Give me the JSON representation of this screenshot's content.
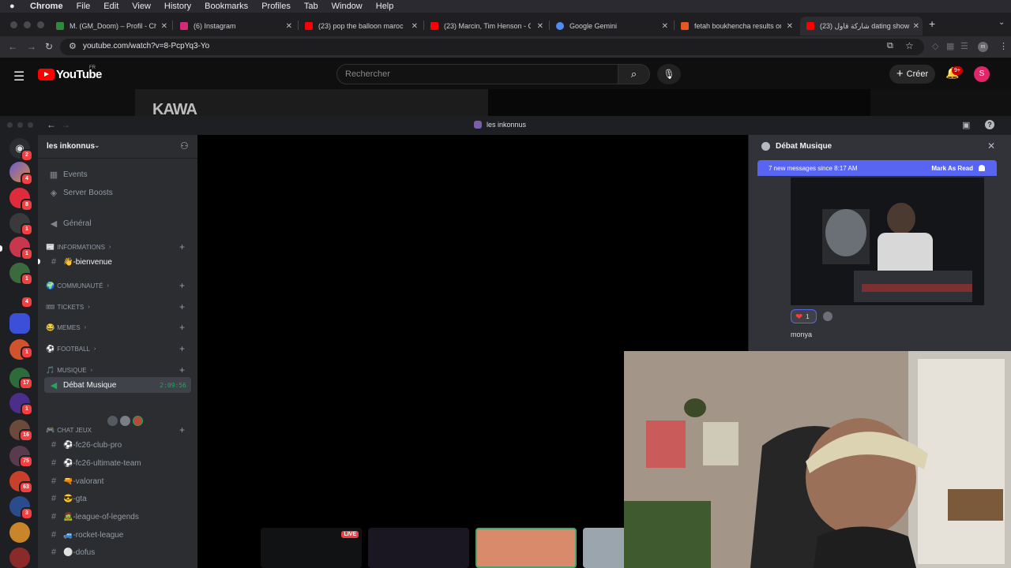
{
  "menubar": {
    "app": "Chrome",
    "items": [
      "File",
      "Edit",
      "View",
      "History",
      "Bookmarks",
      "Profiles",
      "Tab",
      "Window",
      "Help"
    ]
  },
  "tabs": [
    {
      "title": "M. (GM_Doom) – Profil - Che",
      "favicon_color": "#2f8a3c"
    },
    {
      "title": "(6) Instagram",
      "favicon_color": "#d62976"
    },
    {
      "title": "(23) pop the balloon maroc -",
      "favicon_color": "#ff0000"
    },
    {
      "title": "(23) Marcin, Tim Henson - Cl",
      "favicon_color": "#ff0000"
    },
    {
      "title": "Google Gemini",
      "favicon_color": "#4f8df5"
    },
    {
      "title": "fetah boukhencha results on",
      "favicon_color": "#e8571f"
    },
    {
      "title": "(23) شاركة قاول dating show",
      "favicon_color": "#ff0000",
      "active": true
    }
  ],
  "address_bar": {
    "url": "youtube.com/watch?v=8-PcpYq3-Yo"
  },
  "youtube": {
    "brand": "YouTube",
    "region": "FR",
    "search_placeholder": "Rechercher",
    "create_label": "Créer",
    "notifications_badge": "9+",
    "avatar_letter": "S",
    "video_caption": "KAWA"
  },
  "discord": {
    "window_title": "les inkonnus",
    "server_name": "les inkonnus",
    "guild_badges": [
      "2",
      "4",
      "8",
      "1",
      "1",
      "1",
      "4",
      "1",
      "17",
      "1",
      "16",
      "75",
      "63",
      "3"
    ],
    "top_rows": [
      {
        "label": "Events",
        "icon": "calendar-icon"
      },
      {
        "label": "Server Boosts",
        "icon": "boost-icon"
      },
      {
        "label": "Général",
        "icon": "speaker-icon"
      }
    ],
    "categories": [
      {
        "emoji": "📰",
        "label": "INFORMATIONS"
      },
      {
        "emoji": "🌍",
        "label": "COMMUNAUTÉ"
      },
      {
        "emoji": "🎟",
        "label": "TICKETS"
      },
      {
        "emoji": "😂",
        "label": "MEMES"
      },
      {
        "emoji": "⚽",
        "label": "FOOTBALL"
      },
      {
        "emoji": "🎵",
        "label": "MUSIQUE"
      },
      {
        "emoji": "🎮",
        "label": "CHAT JEUX"
      }
    ],
    "bienvenue": "👋-bienvenue",
    "voice_channel": {
      "label": "Débat Musique",
      "time": "2:09:56"
    },
    "game_channels": [
      "⚽-fc26-club-pro",
      "⚽-fc26-ultimate-team",
      "🔫-valorant",
      "😎-gta",
      "🧟-league-of-legends",
      "🚙-rocket-league",
      "⚪-dofus"
    ],
    "thread": {
      "title": "Débat Musique",
      "new_messages": "7 new messages since 8:17 AM",
      "mark_read": "Mark As Read",
      "reaction_count": "1",
      "author": "monya"
    },
    "live_label": "LIVE"
  }
}
